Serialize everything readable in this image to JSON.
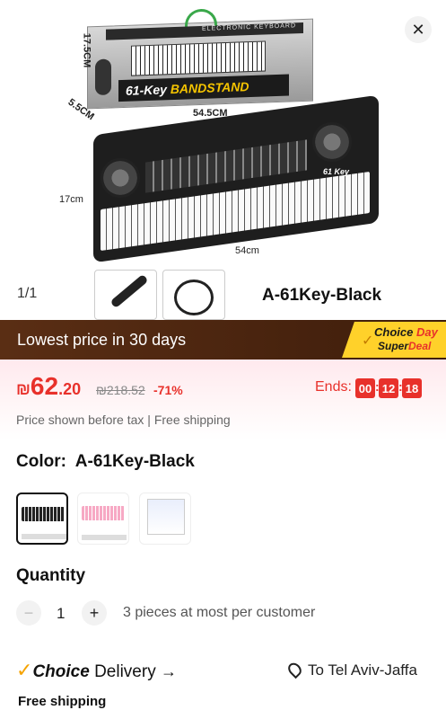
{
  "gallery": {
    "counter": "1/1",
    "box_top_text": "ELECTRONIC KEYBOARD",
    "box_label_prefix": "61-Key",
    "box_label_suffix": "BANDSTAND",
    "dim_height": "17.5CM",
    "dim_depth": "5.5CM",
    "dim_box_width": "54.5CM",
    "dim_kb_height": "17cm",
    "dim_kb_width": "54cm",
    "kb_brand": "61 Key",
    "variant_label": "A-61Key-Black"
  },
  "banner": {
    "text": "Lowest price in 30 days",
    "badge_line1_a": "Choice ",
    "badge_line1_b": "Day",
    "badge_line2_a": "Super",
    "badge_line2_b": "Deal"
  },
  "price": {
    "currency": "₪",
    "main": "62",
    "decimal": ".20",
    "original": "₪218.52",
    "discount": "-71%",
    "ends_label": "Ends:",
    "timer": [
      "00",
      "12",
      "18"
    ],
    "tax_note": "Price shown before tax | Free shipping"
  },
  "color": {
    "label": "Color:",
    "value": "A-61Key-Black"
  },
  "quantity": {
    "title": "Quantity",
    "value": "1",
    "note": "3 pieces at most per customer"
  },
  "delivery": {
    "choice": "Choice",
    "label": "Delivery",
    "arrow": "→",
    "location": "To Tel Aviv-Jaffa",
    "free_shipping": "Free shipping"
  },
  "colors": {
    "accent_red": "#e8312b",
    "banner_brown": "#4a230e",
    "choice_yellow": "#ffd12a"
  }
}
